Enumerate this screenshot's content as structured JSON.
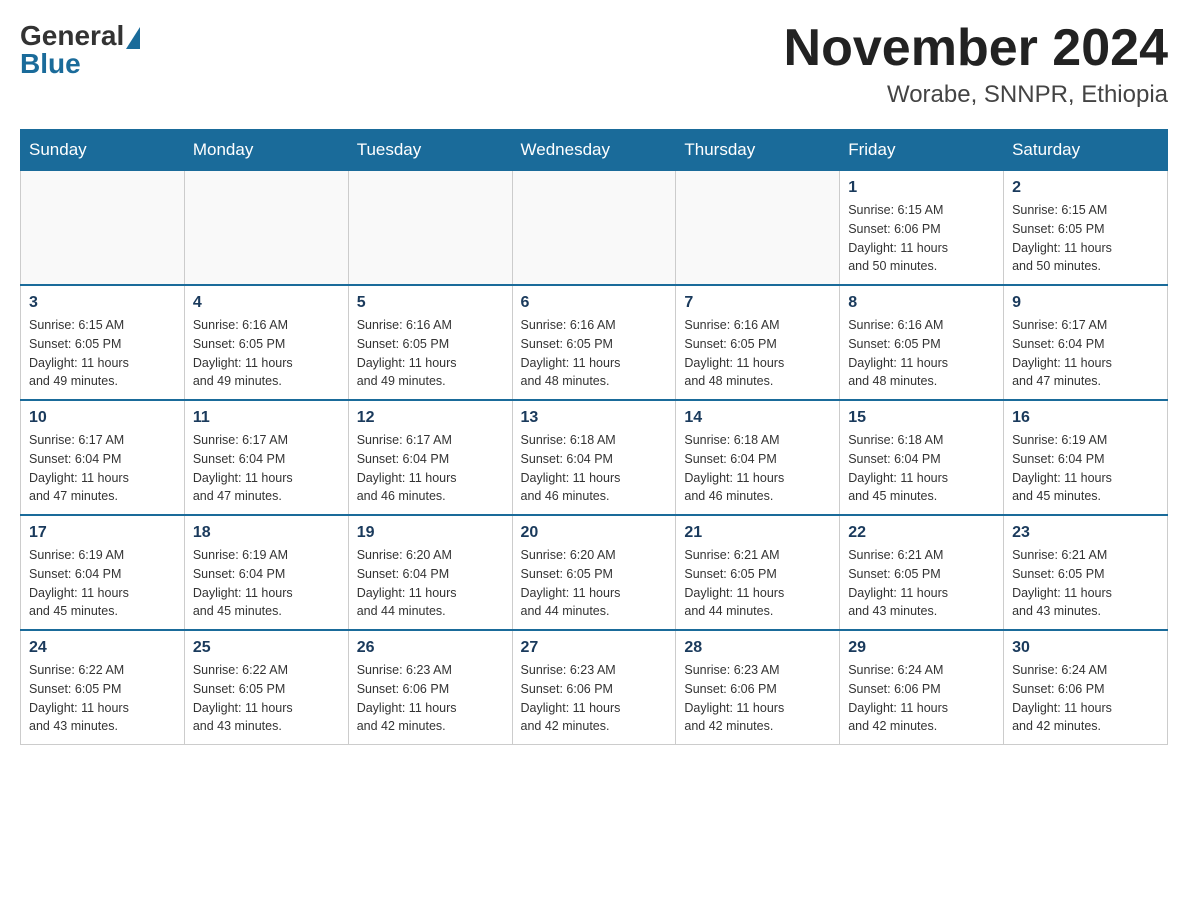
{
  "header": {
    "logo_general": "General",
    "logo_blue": "Blue",
    "month_title": "November 2024",
    "location": "Worabe, SNNPR, Ethiopia"
  },
  "weekdays": [
    "Sunday",
    "Monday",
    "Tuesday",
    "Wednesday",
    "Thursday",
    "Friday",
    "Saturday"
  ],
  "weeks": [
    [
      {
        "day": "",
        "info": ""
      },
      {
        "day": "",
        "info": ""
      },
      {
        "day": "",
        "info": ""
      },
      {
        "day": "",
        "info": ""
      },
      {
        "day": "",
        "info": ""
      },
      {
        "day": "1",
        "info": "Sunrise: 6:15 AM\nSunset: 6:06 PM\nDaylight: 11 hours\nand 50 minutes."
      },
      {
        "day": "2",
        "info": "Sunrise: 6:15 AM\nSunset: 6:05 PM\nDaylight: 11 hours\nand 50 minutes."
      }
    ],
    [
      {
        "day": "3",
        "info": "Sunrise: 6:15 AM\nSunset: 6:05 PM\nDaylight: 11 hours\nand 49 minutes."
      },
      {
        "day": "4",
        "info": "Sunrise: 6:16 AM\nSunset: 6:05 PM\nDaylight: 11 hours\nand 49 minutes."
      },
      {
        "day": "5",
        "info": "Sunrise: 6:16 AM\nSunset: 6:05 PM\nDaylight: 11 hours\nand 49 minutes."
      },
      {
        "day": "6",
        "info": "Sunrise: 6:16 AM\nSunset: 6:05 PM\nDaylight: 11 hours\nand 48 minutes."
      },
      {
        "day": "7",
        "info": "Sunrise: 6:16 AM\nSunset: 6:05 PM\nDaylight: 11 hours\nand 48 minutes."
      },
      {
        "day": "8",
        "info": "Sunrise: 6:16 AM\nSunset: 6:05 PM\nDaylight: 11 hours\nand 48 minutes."
      },
      {
        "day": "9",
        "info": "Sunrise: 6:17 AM\nSunset: 6:04 PM\nDaylight: 11 hours\nand 47 minutes."
      }
    ],
    [
      {
        "day": "10",
        "info": "Sunrise: 6:17 AM\nSunset: 6:04 PM\nDaylight: 11 hours\nand 47 minutes."
      },
      {
        "day": "11",
        "info": "Sunrise: 6:17 AM\nSunset: 6:04 PM\nDaylight: 11 hours\nand 47 minutes."
      },
      {
        "day": "12",
        "info": "Sunrise: 6:17 AM\nSunset: 6:04 PM\nDaylight: 11 hours\nand 46 minutes."
      },
      {
        "day": "13",
        "info": "Sunrise: 6:18 AM\nSunset: 6:04 PM\nDaylight: 11 hours\nand 46 minutes."
      },
      {
        "day": "14",
        "info": "Sunrise: 6:18 AM\nSunset: 6:04 PM\nDaylight: 11 hours\nand 46 minutes."
      },
      {
        "day": "15",
        "info": "Sunrise: 6:18 AM\nSunset: 6:04 PM\nDaylight: 11 hours\nand 45 minutes."
      },
      {
        "day": "16",
        "info": "Sunrise: 6:19 AM\nSunset: 6:04 PM\nDaylight: 11 hours\nand 45 minutes."
      }
    ],
    [
      {
        "day": "17",
        "info": "Sunrise: 6:19 AM\nSunset: 6:04 PM\nDaylight: 11 hours\nand 45 minutes."
      },
      {
        "day": "18",
        "info": "Sunrise: 6:19 AM\nSunset: 6:04 PM\nDaylight: 11 hours\nand 45 minutes."
      },
      {
        "day": "19",
        "info": "Sunrise: 6:20 AM\nSunset: 6:04 PM\nDaylight: 11 hours\nand 44 minutes."
      },
      {
        "day": "20",
        "info": "Sunrise: 6:20 AM\nSunset: 6:05 PM\nDaylight: 11 hours\nand 44 minutes."
      },
      {
        "day": "21",
        "info": "Sunrise: 6:21 AM\nSunset: 6:05 PM\nDaylight: 11 hours\nand 44 minutes."
      },
      {
        "day": "22",
        "info": "Sunrise: 6:21 AM\nSunset: 6:05 PM\nDaylight: 11 hours\nand 43 minutes."
      },
      {
        "day": "23",
        "info": "Sunrise: 6:21 AM\nSunset: 6:05 PM\nDaylight: 11 hours\nand 43 minutes."
      }
    ],
    [
      {
        "day": "24",
        "info": "Sunrise: 6:22 AM\nSunset: 6:05 PM\nDaylight: 11 hours\nand 43 minutes."
      },
      {
        "day": "25",
        "info": "Sunrise: 6:22 AM\nSunset: 6:05 PM\nDaylight: 11 hours\nand 43 minutes."
      },
      {
        "day": "26",
        "info": "Sunrise: 6:23 AM\nSunset: 6:06 PM\nDaylight: 11 hours\nand 42 minutes."
      },
      {
        "day": "27",
        "info": "Sunrise: 6:23 AM\nSunset: 6:06 PM\nDaylight: 11 hours\nand 42 minutes."
      },
      {
        "day": "28",
        "info": "Sunrise: 6:23 AM\nSunset: 6:06 PM\nDaylight: 11 hours\nand 42 minutes."
      },
      {
        "day": "29",
        "info": "Sunrise: 6:24 AM\nSunset: 6:06 PM\nDaylight: 11 hours\nand 42 minutes."
      },
      {
        "day": "30",
        "info": "Sunrise: 6:24 AM\nSunset: 6:06 PM\nDaylight: 11 hours\nand 42 minutes."
      }
    ]
  ]
}
